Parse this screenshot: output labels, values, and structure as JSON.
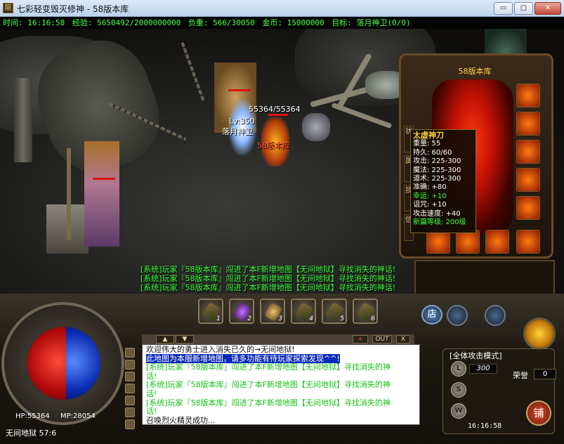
{
  "window": {
    "title": "七彩轻变毁灭修神 - 58版本库",
    "icon_glyph": "龍",
    "min_glyph": "▭",
    "max_glyph": "▢",
    "close_glyph": "✕"
  },
  "status": {
    "time": "时间: 16:16:58",
    "exp": "经验: 5650492/2000000000",
    "weight": "负重: 566/30050",
    "gold": "金币: 15000000",
    "target": "目标: 落月神卫(0/0)"
  },
  "scene": {
    "npc_hp": "55364/55364",
    "npc_level": "Lv:350",
    "npc_name": "落月神卫",
    "player_name": "58版本库"
  },
  "system_overlay": [
    "[系统]玩家『58版本库』闯进了本F新增地图【无间地狱】寻找消失的神话!",
    "[系统]玩家『58版本库』闯进了本F新增地图【无间地狱】寻找消失的神话!",
    "[系统]玩家『58版本库』闯进了本F新增地图【无间地狱】寻找消失的神话!"
  ],
  "equipment": {
    "title": "58版本库",
    "tabs": [
      "状",
      "属",
      "技",
      "信"
    ]
  },
  "tooltip": {
    "name": "太虚神刀",
    "lines": [
      "重量: 55",
      "持久: 60/60",
      "攻击: 225-300",
      "魔法: 225-300",
      "道术: 225-300",
      "准确: +80"
    ],
    "luck": "幸运: +10",
    "lines2": [
      "诅咒: +10",
      "攻击速度: +40"
    ],
    "set": "新篇等级: 200级"
  },
  "hud": {
    "hp": "HP:55364",
    "mp": "MP:28054",
    "map": "无间地狱 57:6",
    "quick_slots": [
      "1",
      "2",
      "3",
      "4",
      "5",
      "6"
    ],
    "chat_toolbar": {
      "plus": "+",
      "out": "OUT",
      "x": "X"
    },
    "mode": "[全体攻击模式]",
    "level_value": "300",
    "reputation_label": "荣誉",
    "reputation_value": "0",
    "clock": "16:16:58",
    "shop_glyph": "铺",
    "store_glyph": "店",
    "lvl_glyphs": [
      "L",
      "S",
      "W"
    ]
  },
  "chat": [
    {
      "type": "plain",
      "text": "欢迎伟大的勇士进入消失已久的→无间地狱!"
    },
    {
      "type": "hl",
      "text": "此地图为本服新增地图，请多功能有待玩家探索发现^^!"
    },
    {
      "type": "sys",
      "text": "[系统]玩家『58版本库』闯进了本F新增地图【无间地狱】寻找消失的神"
    },
    {
      "type": "sys",
      "text": "话!"
    },
    {
      "type": "sys",
      "text": "[系统]玩家『58版本库』闯进了本F新增地图【无间地狱】寻找消失的神"
    },
    {
      "type": "sys",
      "text": "话!"
    },
    {
      "type": "sys",
      "text": "[系统]玩家『58版本库』闯进了本F新增地图【无间地狱】寻找消失的神"
    },
    {
      "type": "sys",
      "text": "话!"
    },
    {
      "type": "plain",
      "text": "召唤烈火精灵成功..."
    }
  ]
}
